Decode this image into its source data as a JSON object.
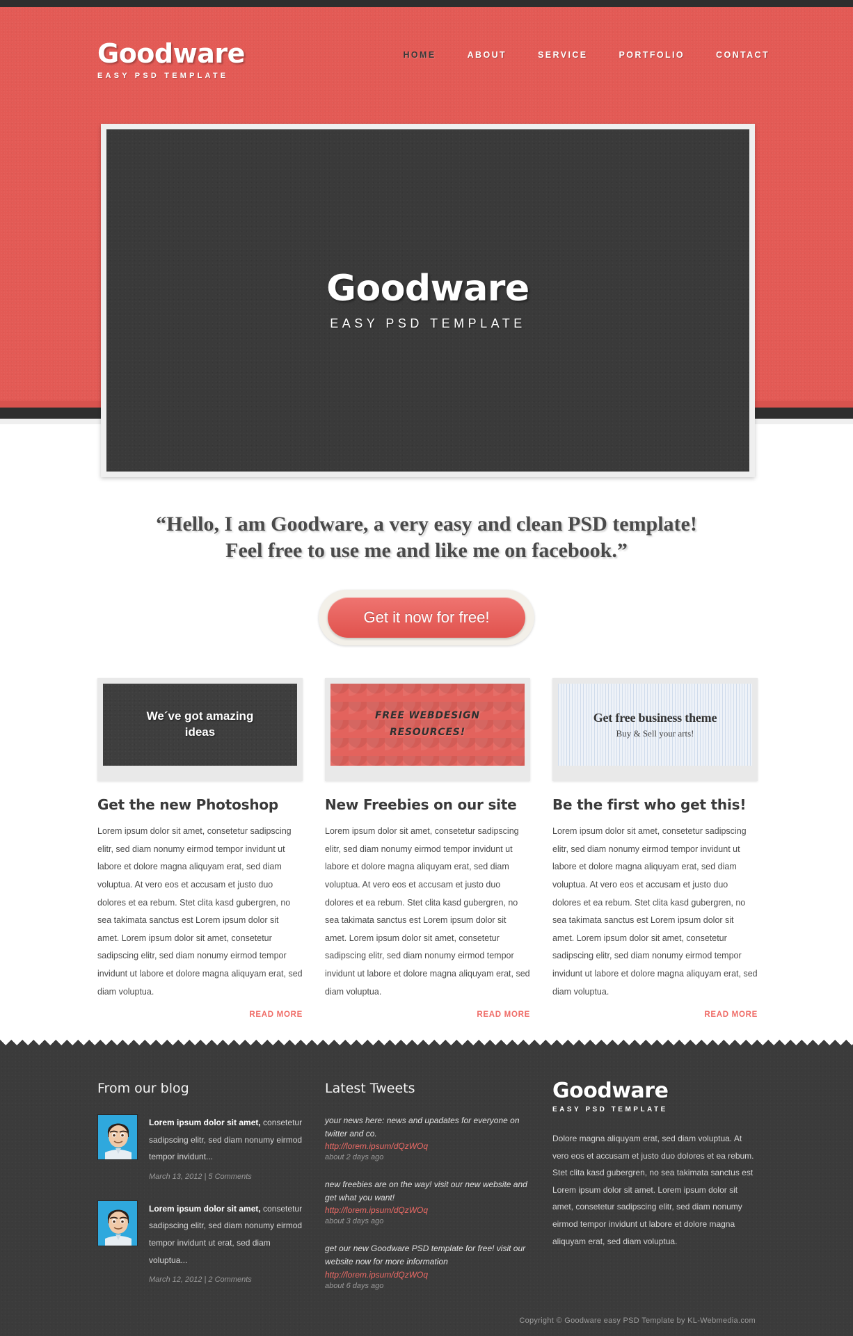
{
  "colors": {
    "brand_red": "#e35a55",
    "accent_red": "#ef6b66",
    "dark": "#3b3b3b",
    "light_bg": "#efefef"
  },
  "header": {
    "logo": {
      "main": "Goodware",
      "sub": "EASY PSD TEMPLATE"
    },
    "nav": [
      {
        "label": "HOME",
        "active": true
      },
      {
        "label": "ABOUT",
        "active": false
      },
      {
        "label": "SERVICE",
        "active": false
      },
      {
        "label": "PORTFOLIO",
        "active": false
      },
      {
        "label": "CONTACT",
        "active": false
      }
    ]
  },
  "hero": {
    "title": "Goodware",
    "subtitle": "EASY PSD TEMPLATE"
  },
  "quote": {
    "line1": "“Hello, I am Goodware, a very easy and clean PSD template!",
    "line2": "Feel free to use me and like me on facebook.”"
  },
  "cta": {
    "label": "Get it now for free!"
  },
  "columns": [
    {
      "thumb_style": "dark",
      "thumb_line1": "We´ve got amazing",
      "thumb_line2": "ideas",
      "heading": "Get the new Photoshop",
      "body": "Lorem ipsum dolor sit amet, consetetur sadipscing elitr, sed diam nonumy eirmod tempor invidunt ut labore et dolore magna aliquyam erat, sed diam voluptua. At vero eos et accusam et justo duo dolores et ea rebum. Stet clita kasd gubergren, no sea takimata sanctus est Lorem ipsum dolor sit amet. Lorem ipsum dolor sit amet, consetetur sadipscing elitr, sed diam nonumy eirmod tempor invidunt ut labore et dolore magna aliquyam erat, sed diam voluptua.",
      "read_more": "READ MORE"
    },
    {
      "thumb_style": "red",
      "thumb_line1": "FREE WEBDESIGN",
      "thumb_line2": "RESOURCES!",
      "heading": "New Freebies on our site",
      "body": "Lorem ipsum dolor sit amet, consetetur sadipscing elitr, sed diam nonumy eirmod tempor invidunt ut labore et dolore magna aliquyam erat, sed diam voluptua. At vero eos et accusam et justo duo dolores et ea rebum. Stet clita kasd gubergren, no sea takimata sanctus est Lorem ipsum dolor sit amet. Lorem ipsum dolor sit amet, consetetur sadipscing elitr, sed diam nonumy eirmod tempor invidunt ut labore et dolore magna aliquyam erat, sed diam voluptua.",
      "read_more": "READ MORE"
    },
    {
      "thumb_style": "blue",
      "thumb_line1": "Get free business theme",
      "thumb_line2": "Buy & Sell your arts!",
      "heading": "Be the first who get this!",
      "body": "Lorem ipsum dolor sit amet, consetetur sadipscing elitr, sed diam nonumy eirmod tempor invidunt ut labore et dolore magna aliquyam erat, sed diam voluptua. At vero eos et accusam et justo duo dolores et ea rebum. Stet clita kasd gubergren, no sea takimata sanctus est Lorem ipsum dolor sit amet. Lorem ipsum dolor sit amet, consetetur sadipscing elitr, sed diam nonumy eirmod tempor invidunt ut labore et dolore magna aliquyam erat, sed diam voluptua.",
      "read_more": "READ MORE"
    }
  ],
  "footer": {
    "blog": {
      "title": "From our blog",
      "posts": [
        {
          "excerpt_bold": "Lorem ipsum dolor sit amet,",
          "excerpt_rest": " consetetur sadipscing elitr, sed diam nonumy eirmod tempor invidunt...",
          "meta": "March 13, 2012 | 5 Comments"
        },
        {
          "excerpt_bold": "Lorem ipsum dolor sit amet,",
          "excerpt_rest": " consetetur sadipscing elitr, sed diam nonumy eirmod tempor invidunt ut erat, sed diam voluptua...",
          "meta": "March 12, 2012 | 2 Comments"
        }
      ]
    },
    "tweets": {
      "title": "Latest Tweets",
      "items": [
        {
          "text": "your news here: news and upadates for everyone on twitter and co.",
          "link": "http://lorem.ipsum/dQzWOq",
          "time": "about 2 days ago"
        },
        {
          "text": "new freebies are on the way! visit our new website and get what you want!",
          "link": "http://lorem.ipsum/dQzWOq",
          "time": "about 3 days ago"
        },
        {
          "text": "get our new Goodware PSD template for free! visit our website now for more information",
          "link": "http://lorem.ipsum/dQzWOq",
          "time": "about 6 days ago"
        }
      ]
    },
    "about": {
      "logo_main": "Goodware",
      "logo_sub": "EASY PSD TEMPLATE",
      "text": "Dolore magna aliquyam erat, sed diam voluptua. At vero eos et accusam et justo duo dolores et ea rebum. Stet clita kasd gubergren, no sea takimata sanctus est Lorem ipsum dolor sit amet. Lorem ipsum dolor sit amet, consetetur sadipscing elitr, sed diam nonumy eirmod tempor invidunt ut labore et dolore magna aliquyam erat, sed diam voluptua."
    },
    "copyright": "Copyright © Goodware easy PSD Template by KL-Webmedia.com"
  }
}
